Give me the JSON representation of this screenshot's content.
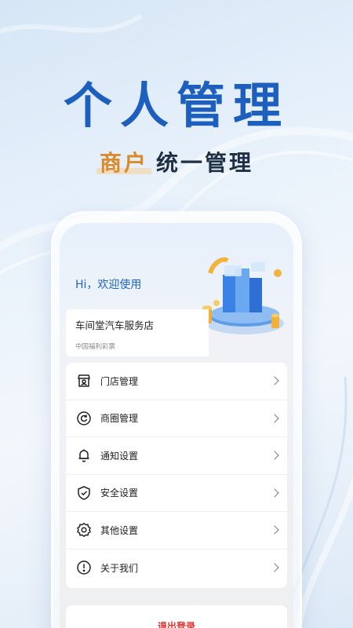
{
  "hero": {
    "title": "个人管理",
    "subtitle_accent": "商户",
    "subtitle_rest": "统一管理"
  },
  "screen": {
    "greeting": "Hi，欢迎使用",
    "store": {
      "name": "车间堂汽车服务店",
      "tag": "中国福利彩票"
    },
    "menu": [
      {
        "label": "门店管理",
        "icon": "store-icon"
      },
      {
        "label": "商圈管理",
        "icon": "circle-refresh-icon"
      },
      {
        "label": "通知设置",
        "icon": "bell-icon"
      },
      {
        "label": "安全设置",
        "icon": "shield-check-icon"
      },
      {
        "label": "其他设置",
        "icon": "gear-icon"
      },
      {
        "label": "关于我们",
        "icon": "info-icon"
      }
    ],
    "logout_label": "退出登录"
  },
  "colors": {
    "brand_blue": "#1d5fbe",
    "accent_orange": "#d98a2b",
    "logout_red": "#e0302b"
  }
}
